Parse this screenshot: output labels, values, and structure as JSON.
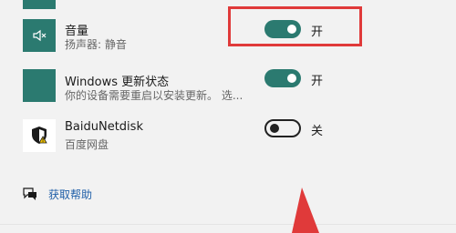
{
  "notifications": {
    "items": [
      {
        "title": "音量",
        "subtitle": "扬声器: 静音",
        "toggle_label": "开",
        "toggle_state": "on",
        "icon": "mute-speaker-icon"
      },
      {
        "title": "Windows 更新状态",
        "subtitle": "你的设备需要重启以安装更新。 选...",
        "toggle_label": "开",
        "toggle_state": "on",
        "icon": "windows-update-icon"
      },
      {
        "title": "BaiduNetdisk",
        "subtitle": "百度网盘",
        "toggle_label": "关",
        "toggle_state": "off",
        "icon": "baidunetdisk-shield-icon"
      }
    ]
  },
  "help": {
    "label": "获取帮助",
    "icon": "help-chat-icon"
  },
  "colors": {
    "accent": "#2b7a70",
    "highlight": "#e03a3a",
    "link": "#1f5fa8",
    "background": "#f2f2f2"
  }
}
